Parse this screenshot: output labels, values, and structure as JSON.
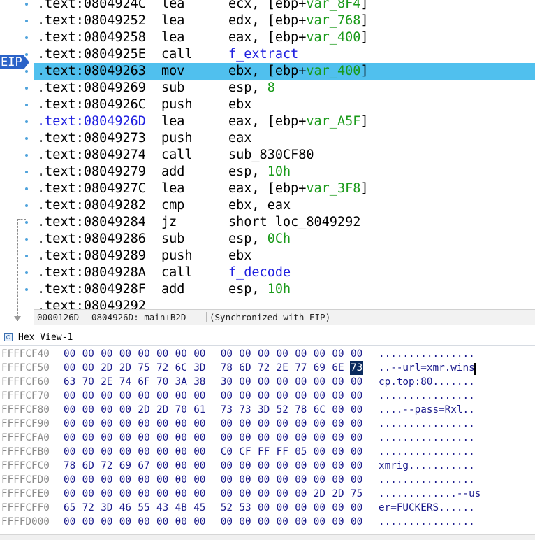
{
  "disasm": {
    "rows": [
      {
        "addr": ".text:0804924C",
        "mnemonic": "lea",
        "operands": [
          {
            "t": "ecx, [ebp+",
            "c": "sp"
          },
          {
            "t": "var_8F4",
            "c": "stk"
          },
          {
            "t": "]",
            "c": "sp"
          }
        ]
      },
      {
        "addr": ".text:08049252",
        "mnemonic": "lea",
        "operands": [
          {
            "t": "edx, [ebp+",
            "c": "sp"
          },
          {
            "t": "var_768",
            "c": "stk"
          },
          {
            "t": "]",
            "c": "sp"
          }
        ]
      },
      {
        "addr": ".text:08049258",
        "mnemonic": "lea",
        "operands": [
          {
            "t": "eax, [ebp+",
            "c": "sp"
          },
          {
            "t": "var_400",
            "c": "stk"
          },
          {
            "t": "]",
            "c": "sp"
          }
        ]
      },
      {
        "addr": ".text:0804925E",
        "mnemonic": "call",
        "operands": [
          {
            "t": "f_extract",
            "c": "fn"
          }
        ]
      },
      {
        "addr": ".text:08049263",
        "mnemonic": "mov",
        "operands": [
          {
            "t": "ebx, [ebp+",
            "c": "sp"
          },
          {
            "t": "var_400",
            "c": "stk"
          },
          {
            "t": "]",
            "c": "sp"
          }
        ]
      },
      {
        "addr": ".text:08049269",
        "mnemonic": "sub",
        "operands": [
          {
            "t": "esp, ",
            "c": "sp"
          },
          {
            "t": "8",
            "c": "num"
          }
        ]
      },
      {
        "addr": ".text:0804926C",
        "mnemonic": "push",
        "operands": [
          {
            "t": "ebx",
            "c": "sp"
          }
        ]
      },
      {
        "addr": ".text:0804926D",
        "mnemonic": "lea",
        "operands": [
          {
            "t": "eax, [ebp+",
            "c": "sp"
          },
          {
            "t": "var_A5F",
            "c": "stk"
          },
          {
            "t": "]",
            "c": "sp"
          }
        ]
      },
      {
        "addr": ".text:08049273",
        "mnemonic": "push",
        "operands": [
          {
            "t": "eax",
            "c": "sp"
          }
        ]
      },
      {
        "addr": ".text:08049274",
        "mnemonic": "call",
        "operands": [
          {
            "t": "sub_830CF80",
            "c": "sp"
          }
        ]
      },
      {
        "addr": ".text:08049279",
        "mnemonic": "add",
        "operands": [
          {
            "t": "esp, ",
            "c": "sp"
          },
          {
            "t": "10h",
            "c": "num"
          }
        ]
      },
      {
        "addr": ".text:0804927C",
        "mnemonic": "lea",
        "operands": [
          {
            "t": "eax, [ebp+",
            "c": "sp"
          },
          {
            "t": "var_3F8",
            "c": "stk"
          },
          {
            "t": "]",
            "c": "sp"
          }
        ]
      },
      {
        "addr": ".text:08049282",
        "mnemonic": "cmp",
        "operands": [
          {
            "t": "ebx, eax",
            "c": "sp"
          }
        ]
      },
      {
        "addr": ".text:08049284",
        "mnemonic": "jz",
        "operands": [
          {
            "t": "short loc_8049292",
            "c": "sp"
          }
        ]
      },
      {
        "addr": ".text:08049286",
        "mnemonic": "sub",
        "operands": [
          {
            "t": "esp, ",
            "c": "sp"
          },
          {
            "t": "0Ch",
            "c": "num"
          }
        ]
      },
      {
        "addr": ".text:08049289",
        "mnemonic": "push",
        "operands": [
          {
            "t": "ebx",
            "c": "sp"
          }
        ]
      },
      {
        "addr": ".text:0804928A",
        "mnemonic": "call",
        "operands": [
          {
            "t": "f_decode",
            "c": "fn"
          }
        ]
      },
      {
        "addr": ".text:0804928F",
        "mnemonic": "add",
        "operands": [
          {
            "t": "esp, ",
            "c": "sp"
          },
          {
            "t": "10h",
            "c": "num"
          }
        ]
      },
      {
        "addr": ".text:08049292",
        "mnemonic": "",
        "operands": []
      }
    ],
    "highlighted_index": 4,
    "cursor_index": 7,
    "eip_label": "EIP",
    "status": {
      "offset": "0000126D",
      "location": "0804926D: main+B2D",
      "sync": "(Synchronized with EIP)"
    }
  },
  "hexview": {
    "title": "Hex View-1",
    "rows": [
      {
        "addr": "FFFFCF40",
        "bytes": [
          "00",
          "00",
          "00",
          "00",
          "00",
          "00",
          "00",
          "00",
          "00",
          "00",
          "00",
          "00",
          "00",
          "00",
          "00",
          "00"
        ],
        "ascii": "................"
      },
      {
        "addr": "FFFFCF50",
        "bytes": [
          "00",
          "00",
          "2D",
          "2D",
          "75",
          "72",
          "6C",
          "3D",
          "78",
          "6D",
          "72",
          "2E",
          "77",
          "69",
          "6E",
          "73"
        ],
        "ascii": "..--url=xmr.wins"
      },
      {
        "addr": "FFFFCF60",
        "bytes": [
          "63",
          "70",
          "2E",
          "74",
          "6F",
          "70",
          "3A",
          "38",
          "30",
          "00",
          "00",
          "00",
          "00",
          "00",
          "00",
          "00"
        ],
        "ascii": "cp.top:80......."
      },
      {
        "addr": "FFFFCF70",
        "bytes": [
          "00",
          "00",
          "00",
          "00",
          "00",
          "00",
          "00",
          "00",
          "00",
          "00",
          "00",
          "00",
          "00",
          "00",
          "00",
          "00"
        ],
        "ascii": "................"
      },
      {
        "addr": "FFFFCF80",
        "bytes": [
          "00",
          "00",
          "00",
          "00",
          "2D",
          "2D",
          "70",
          "61",
          "73",
          "73",
          "3D",
          "52",
          "78",
          "6C",
          "00",
          "00"
        ],
        "ascii": "....--pass=Rxl.."
      },
      {
        "addr": "FFFFCF90",
        "bytes": [
          "00",
          "00",
          "00",
          "00",
          "00",
          "00",
          "00",
          "00",
          "00",
          "00",
          "00",
          "00",
          "00",
          "00",
          "00",
          "00"
        ],
        "ascii": "................"
      },
      {
        "addr": "FFFFCFA0",
        "bytes": [
          "00",
          "00",
          "00",
          "00",
          "00",
          "00",
          "00",
          "00",
          "00",
          "00",
          "00",
          "00",
          "00",
          "00",
          "00",
          "00"
        ],
        "ascii": "................"
      },
      {
        "addr": "FFFFCFB0",
        "bytes": [
          "00",
          "00",
          "00",
          "00",
          "00",
          "00",
          "00",
          "00",
          "C0",
          "CF",
          "FF",
          "FF",
          "05",
          "00",
          "00",
          "00"
        ],
        "ascii": "................"
      },
      {
        "addr": "FFFFCFC0",
        "bytes": [
          "78",
          "6D",
          "72",
          "69",
          "67",
          "00",
          "00",
          "00",
          "00",
          "00",
          "00",
          "00",
          "00",
          "00",
          "00",
          "00"
        ],
        "ascii": "xmrig..........."
      },
      {
        "addr": "FFFFCFD0",
        "bytes": [
          "00",
          "00",
          "00",
          "00",
          "00",
          "00",
          "00",
          "00",
          "00",
          "00",
          "00",
          "00",
          "00",
          "00",
          "00",
          "00"
        ],
        "ascii": "................"
      },
      {
        "addr": "FFFFCFE0",
        "bytes": [
          "00",
          "00",
          "00",
          "00",
          "00",
          "00",
          "00",
          "00",
          "00",
          "00",
          "00",
          "00",
          "00",
          "2D",
          "2D",
          "75",
          "73"
        ],
        "ascii": ".............--us"
      },
      {
        "addr": "FFFFCFF0",
        "bytes": [
          "65",
          "72",
          "3D",
          "46",
          "55",
          "43",
          "4B",
          "45",
          "52",
          "53",
          "00",
          "00",
          "00",
          "00",
          "00",
          "00"
        ],
        "ascii": "er=FUCKERS......"
      },
      {
        "addr": "FFFFD000",
        "bytes": [
          "00",
          "00",
          "00",
          "00",
          "00",
          "00",
          "00",
          "00",
          "00",
          "00",
          "00",
          "00",
          "00",
          "00",
          "00",
          "00"
        ],
        "ascii": "................"
      }
    ],
    "selected": {
      "row": 1,
      "byte": 15
    },
    "colors": {
      "byte_text": "#1a1a8c",
      "addr_text": "#8a8a8a",
      "selection": "#0a2a5e",
      "highlight_row": "#50c0ee"
    }
  }
}
